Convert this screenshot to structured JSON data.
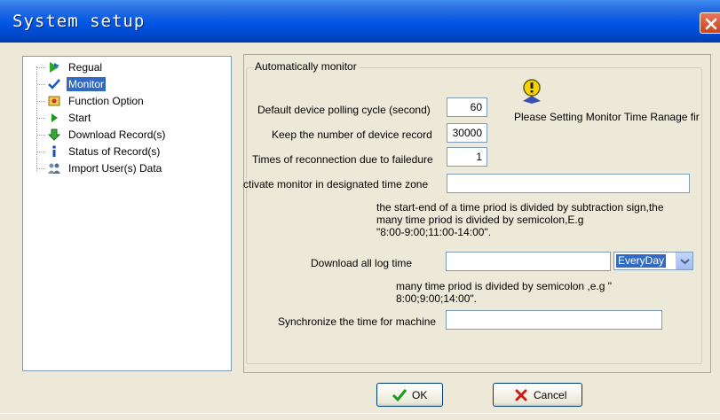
{
  "window": {
    "title": "System setup"
  },
  "tree": {
    "items": [
      {
        "label": "Regual",
        "icon": "green-arrow-icon"
      },
      {
        "label": "Monitor",
        "icon": "checkmark-icon",
        "selected": true
      },
      {
        "label": "Function Option",
        "icon": "option-icon"
      },
      {
        "label": "Start",
        "icon": "play-icon"
      },
      {
        "label": "Download Record(s)",
        "icon": "download-arrow-icon"
      },
      {
        "label": "Status of Record(s)",
        "icon": "info-icon"
      },
      {
        "label": "Import User(s) Data",
        "icon": "users-icon"
      }
    ]
  },
  "monitor": {
    "group_title": "Automatically monitor",
    "info_text": "Please Setting Monitor Time Ranage fir",
    "polling_label": "Default device polling cycle (second)",
    "polling_value": "60",
    "keep_label": "Keep the number of device record",
    "keep_value": "30000",
    "reconnect_label": "Times of reconnection due to failedure",
    "reconnect_value": "1",
    "zone_label": "ctivate monitor in designated time zone",
    "zone_value": "",
    "zone_help": [
      "the start-end of a time priod is divided  by subtraction sign,the",
      "many time priod is divided by semicolon,E.g",
      "\"8:00-9:00;11:00-14:00\"."
    ],
    "download_label": "Download all log time",
    "download_value": "",
    "download_option": "EveryDay",
    "download_help": [
      "many time priod is divided by semicolon ,e.g \"",
      "8:00;9:00;14:00\"."
    ],
    "sync_label": "Synchronize the time for machine",
    "sync_value": ""
  },
  "buttons": {
    "ok": "OK",
    "cancel": "Cancel"
  },
  "colors": {
    "title_bar": "#0055e5",
    "selection": "#316ac5",
    "face": "#ece9d8"
  }
}
